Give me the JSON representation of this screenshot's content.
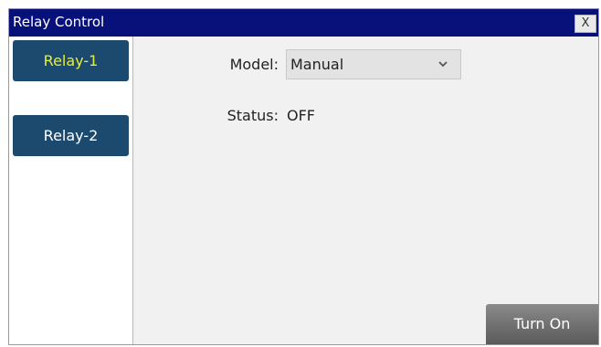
{
  "window": {
    "title": "Relay Control",
    "close_label": "X"
  },
  "sidebar": {
    "items": [
      {
        "label": "Relay-1",
        "active": true
      },
      {
        "label": "Relay-2",
        "active": false
      }
    ]
  },
  "main": {
    "model_label": "Model:",
    "model_value": "Manual",
    "status_label": "Status:",
    "status_value": "OFF",
    "turn_on_label": "Turn On"
  },
  "colors": {
    "titlebar": "#08107a",
    "relay_button": "#1c4a6e",
    "active_text": "#e6ee3a"
  },
  "icons": {
    "dropdown": "chevron-down-icon"
  }
}
